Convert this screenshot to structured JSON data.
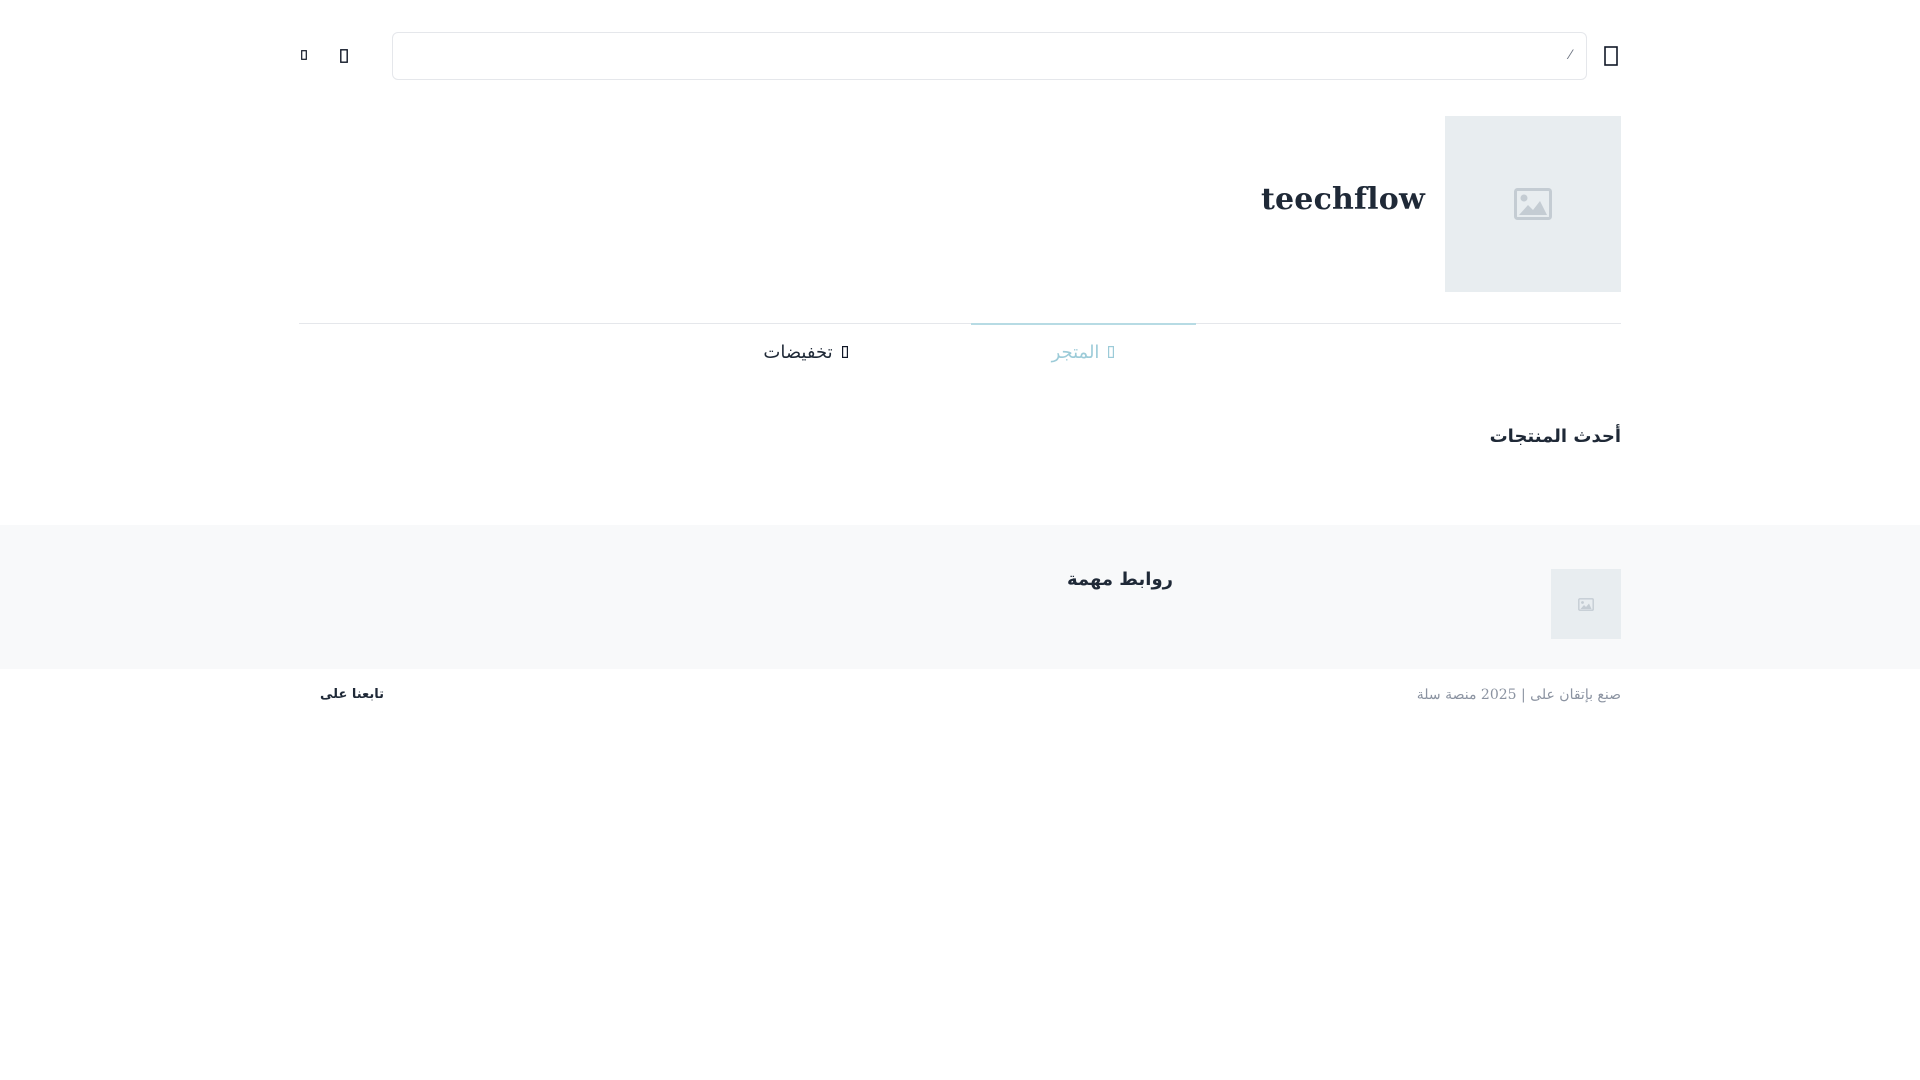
{
  "header": {
    "search_value": "",
    "search_mark": "⁄",
    "icons": [
      "menu-icon",
      "search-icon",
      "user-icon",
      "cart-icon"
    ]
  },
  "store": {
    "name": "teechflow"
  },
  "nav": {
    "items": [
      {
        "label": "المتجر",
        "active": true
      },
      {
        "label": "تخفيضات",
        "active": false
      }
    ]
  },
  "latest": {
    "title": "أحدث المنتجات"
  },
  "footer": {
    "links_title": "روابط مهمة",
    "copyright": "صنع بإتقان على | 2025 منصة سلة",
    "follow_us": "تابعنا على"
  },
  "colors": {
    "accent": "#9ccbd8",
    "placeholder_bg": "#e8edf0",
    "footer_bg": "#f8f9fa",
    "border": "#e5e7eb"
  }
}
